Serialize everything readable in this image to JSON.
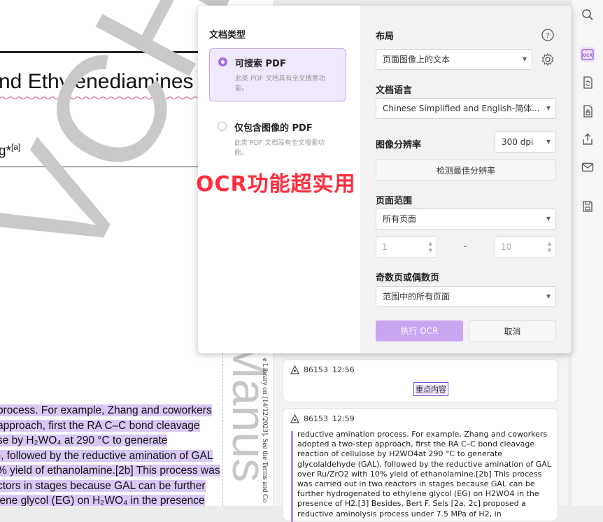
{
  "document": {
    "title": "nd Ethylenediamines",
    "author": "g*",
    "author_sup": "[a]",
    "watermark_big": "VCH",
    "watermark_vertical": "Manus",
    "vertical_note": "e Library on [14/12/2023]. See the Terms and Co",
    "lines": [
      "process. For example, Zhang and coworkers",
      "approach, first the RA C–C bond cleavage",
      "se  by  H₂WO₄  at  290  °C  to  generate",
      "), followed by the reductive amination of GAL",
      "% yield of ethanolamine.[2b] This process was",
      "ctors in stages because GAL can be further",
      "lene glycol (EG) on H₂WO₄ in the presence"
    ]
  },
  "dialog": {
    "doc_type_label": "文档类型",
    "options": [
      {
        "title": "可搜索 PDF",
        "desc": "此类 PDF 文档具有全文搜索功能。",
        "selected": true
      },
      {
        "title": "仅包含图像的 PDF",
        "desc": "此类 PDF 文档没有全文搜索功能。",
        "selected": false
      }
    ],
    "layout_label": "布局",
    "layout_value": "页面图像上的文本",
    "language_label": "文档语言",
    "language_value": "Chinese Simplified and English-简体...",
    "resolution_label": "图像分辨率",
    "resolution_value": "300 dpi",
    "detect_button": "检测最佳分辨率",
    "range_label": "页面范围",
    "range_value": "所有页面",
    "from_page": "1",
    "dash": "-",
    "to_page": "10",
    "odd_even_label": "奇数页或偶数页",
    "odd_even_value": "范围中的所有页面",
    "run_button": "执行 OCR",
    "cancel_button": "取消"
  },
  "banner": "OCR功能超实用",
  "chat": {
    "messages": [
      {
        "user": "86153",
        "time": "12:56",
        "tag": "重点内容"
      },
      {
        "user": "86153",
        "time": "12:59",
        "text": "reductive amination process. For example, Zhang and coworkers adopted a two-step approach, first the RA C–C bond cleavage reaction of cellulose by H2WO4at 290 °C to generate glycolaldehyde (GAL), followed by the reductive amination of GAL over Ru/ZrO2 with 10% yield of ethanolamine.[2b] This process was carried out in two reactors in stages because GAL can be further hydrogenated to ethylene glycol (EG) on H2WO4 in the presence of H2.[3] Besides, Bert F. Sels [2a, 2c] proposed a reductive aminolysis process under 7.5 MPa of H2, in"
      }
    ]
  },
  "colors": {
    "accent": "#a56de2",
    "button": "#c9a6f2",
    "banner": "#ff2d3d",
    "highlight": "#d9c8f6"
  },
  "toolbar": [
    "search-icon",
    "ocr-icon",
    "convert-icon",
    "protect-icon",
    "share-icon",
    "mail-icon",
    "save-icon"
  ]
}
